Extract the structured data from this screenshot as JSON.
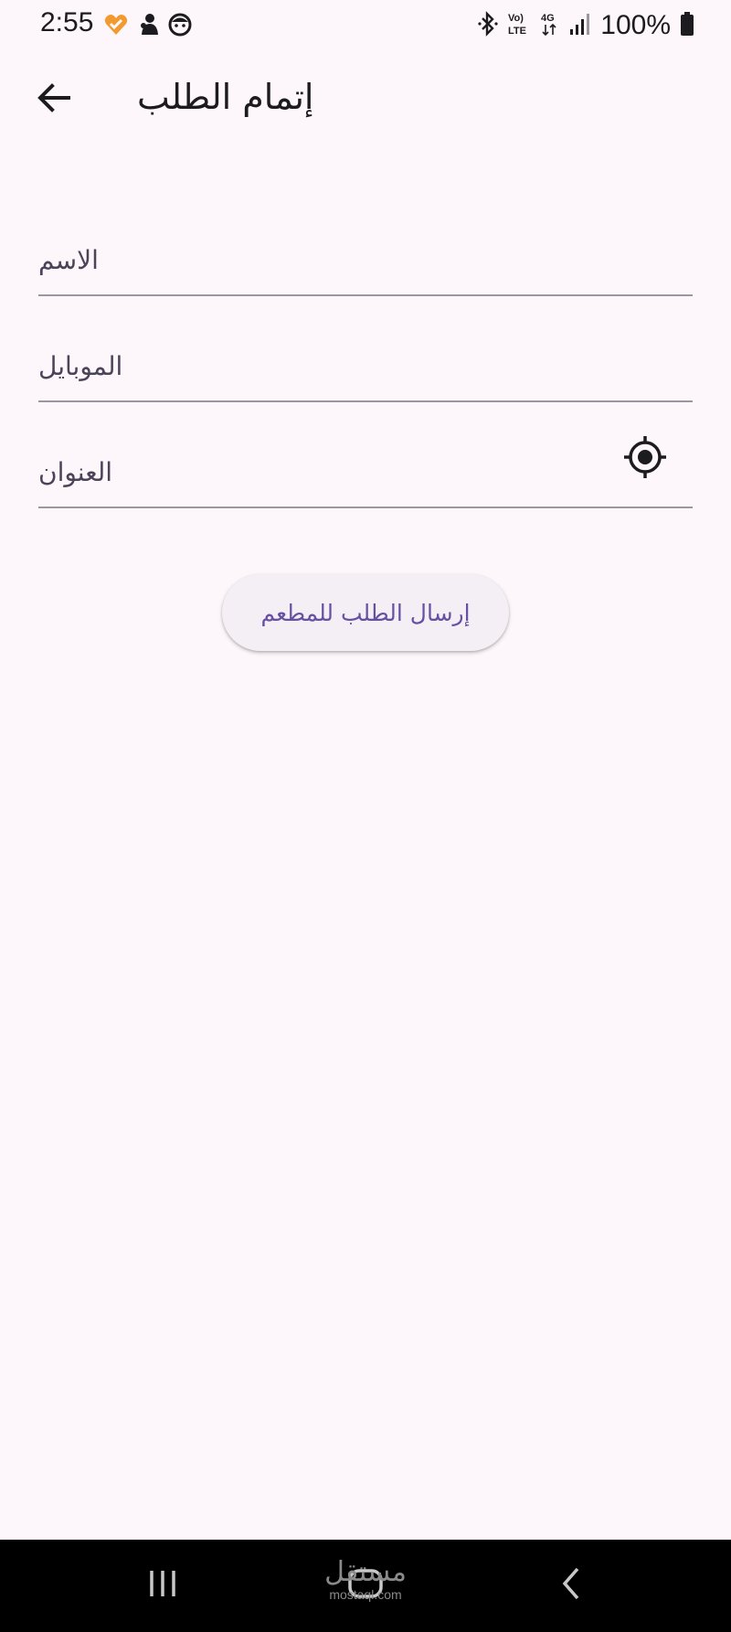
{
  "status_bar": {
    "time": "2:55",
    "battery": "100%",
    "icons": [
      "dating-app-icon",
      "character-icon",
      "face-icon",
      "bluetooth-icon",
      "volte-icon",
      "4g-icon",
      "signal-icon",
      "battery-icon"
    ]
  },
  "app_bar": {
    "title": "إتمام الطلب",
    "back_icon": "arrow-back-icon"
  },
  "form": {
    "name_placeholder": "الاسم",
    "mobile_placeholder": "الموبايل",
    "address_placeholder": "العنوان",
    "location_icon": "my-location-icon"
  },
  "submit_button": {
    "label": "إرسال الطلب للمطعم"
  },
  "nav_bar": {
    "buttons": [
      "recents-icon",
      "home-icon",
      "back-icon"
    ]
  },
  "watermark": {
    "arabic": "مستقل",
    "latin": "mostaql.com"
  },
  "colors": {
    "background": "#fdf7fb",
    "accent": "#6750a4",
    "text": "#1c1b1f",
    "divider": "#9b97a0",
    "button_bg": "#f4eff4",
    "nav_bg": "#000000"
  }
}
